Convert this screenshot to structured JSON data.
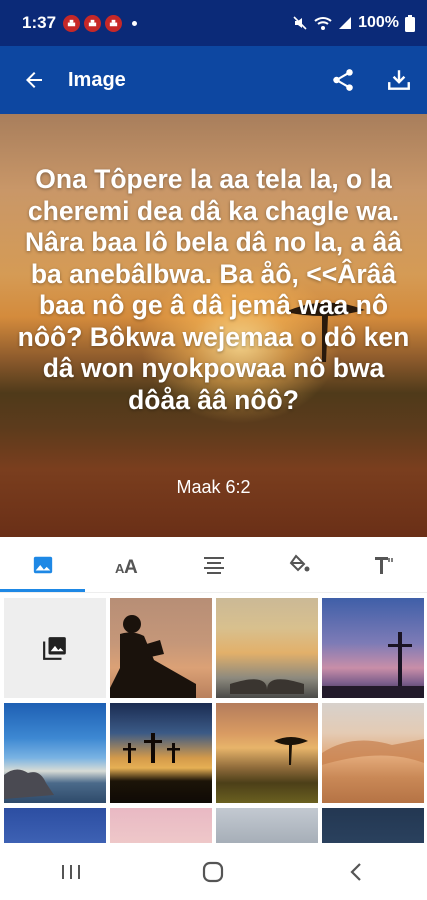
{
  "status_bar": {
    "time": "1:37",
    "battery": "100%",
    "notification_icons": [
      "app-notification-icon",
      "app-notification-icon",
      "app-notification-icon"
    ]
  },
  "app_bar": {
    "title": "Image",
    "actions": [
      "share-icon",
      "download-icon"
    ]
  },
  "verse": {
    "text": "Ona Tôpere la aa tela la, o la cheremi dea dâ ka chagle wa. Nâra baa lô bela dâ no la, a ââ ba anebâlbwa. Ba åô, <<Ârââ baa nô ge â dâ jemâ waa nô nôô? Bôkwa wejemaa o dô ken dâ won nyokpowaa nô bwa dôåa ââ nôô?",
    "reference": "Maak 6:2"
  },
  "tool_tabs": {
    "active": "image",
    "items": [
      "image-icon",
      "font-size-icon",
      "align-center-icon",
      "fill-color-icon",
      "text-style-icon"
    ]
  },
  "backgrounds": {
    "first_cell": "gallery-icon",
    "thumbnails": [
      "child-reading-silhouette",
      "open-book-clouds",
      "cross-twilight",
      "sea-rocks",
      "three-crosses-sunset",
      "acacia-tree-sunset",
      "desert-dunes",
      "blue-sky",
      "pink-sky",
      "mountain-clouds",
      "dark-sky"
    ]
  },
  "nav_bar": {
    "buttons": [
      "recent-apps-icon",
      "home-icon",
      "back-nav-icon"
    ]
  },
  "colors": {
    "status_bar_bg": "#0b2a78",
    "app_bar_bg": "#0d47a1",
    "accent": "#1e88e5"
  }
}
